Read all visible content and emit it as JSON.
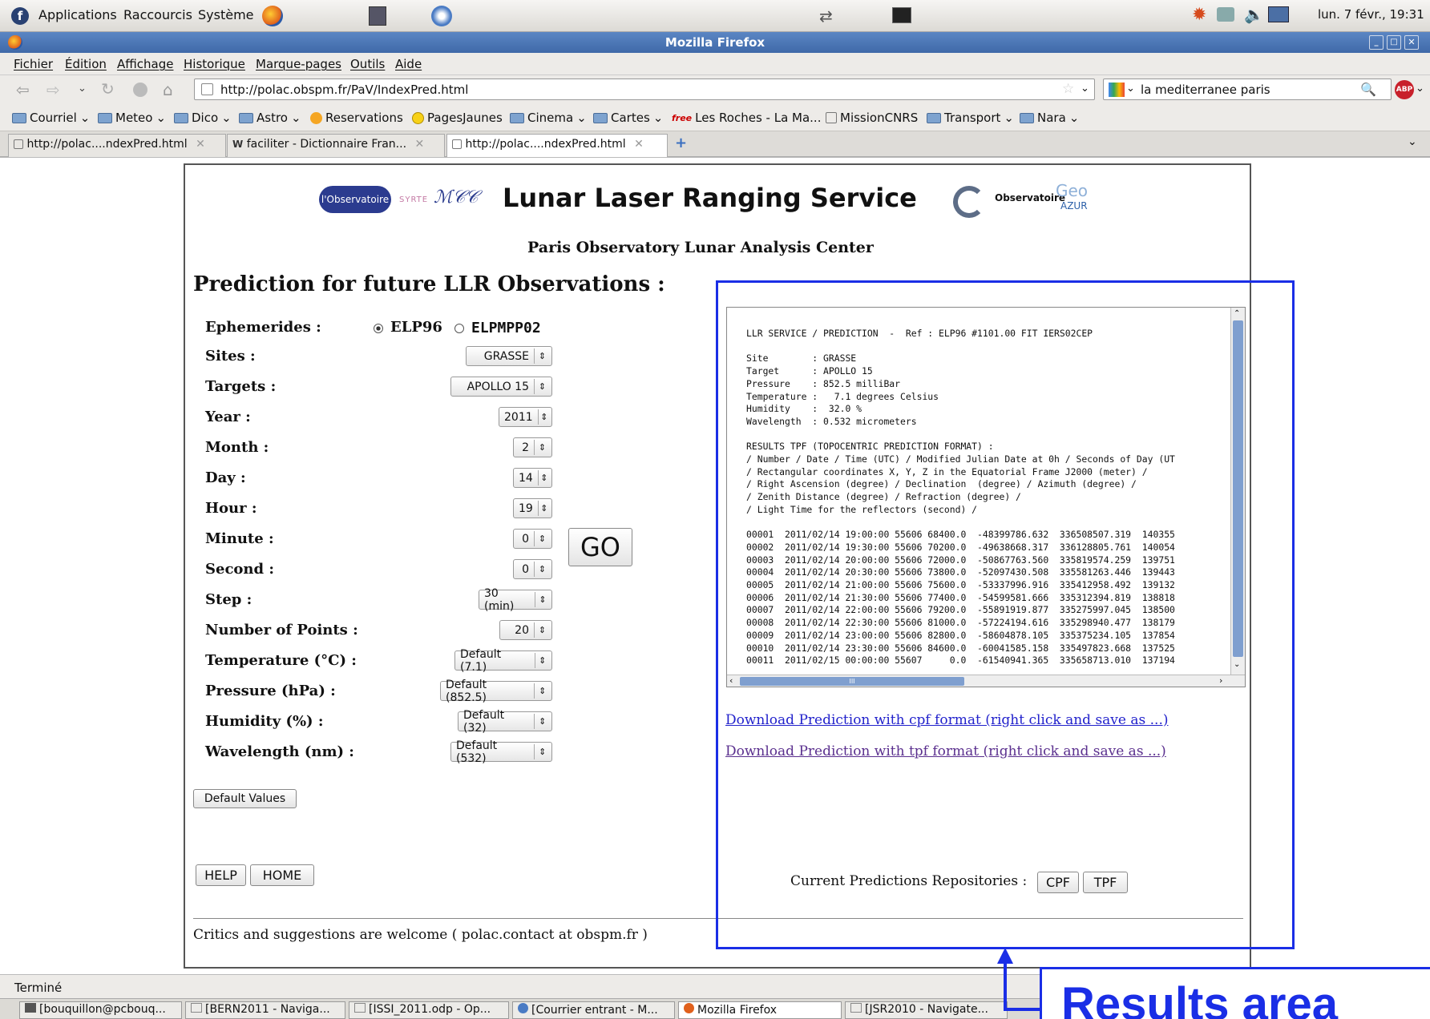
{
  "gnome_panel": {
    "menus": [
      "Applications",
      "Raccourcis",
      "Système"
    ],
    "clock": "lun. 7 févr., 19:31"
  },
  "window": {
    "title": "Mozilla Firefox"
  },
  "menubar": [
    "Fichier",
    "Édition",
    "Affichage",
    "Historique",
    "Marque-pages",
    "Outils",
    "Aide"
  ],
  "navbar": {
    "url": "http://polac.obspm.fr/PaV/IndexPred.html",
    "search": "la mediterranee paris"
  },
  "bookmarks": [
    {
      "label": "Courriel",
      "dropdown": true,
      "icon": "folder-icon"
    },
    {
      "label": "Meteo",
      "dropdown": true,
      "icon": "folder-icon"
    },
    {
      "label": "Dico",
      "dropdown": true,
      "icon": "folder-icon"
    },
    {
      "label": "Astro",
      "dropdown": true,
      "icon": "folder-icon"
    },
    {
      "label": "Reservations",
      "dropdown": false,
      "icon": "reservations-icon"
    },
    {
      "label": "PagesJaunes",
      "dropdown": false,
      "icon": "pagesjaunes-icon"
    },
    {
      "label": "Cinema",
      "dropdown": true,
      "icon": "folder-icon"
    },
    {
      "label": "Cartes",
      "dropdown": true,
      "icon": "folder-icon"
    },
    {
      "label": "Les Roches - La Ma...",
      "dropdown": false,
      "icon": "free-icon"
    },
    {
      "label": "MissionCNRS",
      "dropdown": false,
      "icon": "page-icon"
    },
    {
      "label": "Transport",
      "dropdown": true,
      "icon": "folder-icon"
    },
    {
      "label": "Nara",
      "dropdown": true,
      "icon": "folder-icon"
    }
  ],
  "tabs": [
    {
      "label": "http://polac....ndexPred.html",
      "active": false
    },
    {
      "label": "faciliter - Dictionnaire Fran...",
      "active": false
    },
    {
      "label": "http://polac....ndexPred.html",
      "active": true
    }
  ],
  "header": {
    "logo_observatoire": "l'Observatoire",
    "logo_syrte": "SYRTE",
    "logo_ocazur": "Observatoire",
    "logo_geo": "Geo",
    "logo_azur": "AZUR",
    "title": "Lunar Laser Ranging Service",
    "subtitle": "Paris Observatory Lunar Analysis Center"
  },
  "form": {
    "heading": "Prediction for future LLR Observations :",
    "ephemerides": {
      "label": "Ephemerides :",
      "options": [
        "ELP96",
        "ELPMPP02"
      ],
      "selected": "ELP96"
    },
    "fields": [
      {
        "key": "sites",
        "label": "Sites :",
        "value": "GRASSE"
      },
      {
        "key": "targets",
        "label": "Targets :",
        "value": "APOLLO 15"
      },
      {
        "key": "year",
        "label": "Year :",
        "value": "2011"
      },
      {
        "key": "month",
        "label": "Month :",
        "value": "2"
      },
      {
        "key": "day",
        "label": "Day :",
        "value": "14"
      },
      {
        "key": "hour",
        "label": "Hour :",
        "value": "19"
      },
      {
        "key": "minute",
        "label": "Minute :",
        "value": "0"
      },
      {
        "key": "second",
        "label": "Second :",
        "value": "0"
      },
      {
        "key": "step",
        "label": "Step :",
        "value": "30 (min)"
      },
      {
        "key": "points",
        "label": "Number of Points :",
        "value": "20"
      },
      {
        "key": "temperature",
        "label": "Temperature (°C) :",
        "value": "Default (7.1)"
      },
      {
        "key": "pressure",
        "label": "Pressure (hPa) :",
        "value": "Default (852.5)"
      },
      {
        "key": "humidity",
        "label": "Humidity (%) :",
        "value": "Default (32)"
      },
      {
        "key": "wavelength",
        "label": "Wavelength (nm) :",
        "value": "Default (532)"
      }
    ],
    "go_label": "GO",
    "default_values_label": "Default Values",
    "help_label": "HELP",
    "home_label": "HOME"
  },
  "results": {
    "text": "LLR SERVICE / PREDICTION  -  Ref : ELP96 #1101.00 FIT IERS02CEP\n\nSite        : GRASSE\nTarget      : APOLLO 15\nPressure    : 852.5 milliBar\nTemperature :   7.1 degrees Celsius\nHumidity    :  32.0 %\nWavelength  : 0.532 micrometers\n\nRESULTS TPF (TOPOCENTRIC PREDICTION FORMAT) :\n/ Number / Date / Time (UTC) / Modified Julian Date at 0h / Seconds of Day (UT\n/ Rectangular coordinates X, Y, Z in the Equatorial Frame J2000 (meter) /\n/ Right Ascension (degree) / Declination  (degree) / Azimuth (degree) /\n/ Zenith Distance (degree) / Refraction (degree) /\n/ Light Time for the reflectors (second) /\n\n00001  2011/02/14 19:00:00 55606 68400.0  -48399786.632  336508507.319  140355\n00002  2011/02/14 19:30:00 55606 70200.0  -49638668.317  336128805.761  140054\n00003  2011/02/14 20:00:00 55606 72000.0  -50867763.560  335819574.259  139751\n00004  2011/02/14 20:30:00 55606 73800.0  -52097430.508  335581263.446  139443\n00005  2011/02/14 21:00:00 55606 75600.0  -53337996.916  335412958.492  139132\n00006  2011/02/14 21:30:00 55606 77400.0  -54599581.666  335312394.819  138818\n00007  2011/02/14 22:00:00 55606 79200.0  -55891919.877  335275997.045  138500\n00008  2011/02/14 22:30:00 55606 81000.0  -57224194.616  335298940.477  138179\n00009  2011/02/14 23:00:00 55606 82800.0  -58604878.105  335375234.105  137854\n00010  2011/02/14 23:30:00 55606 84600.0  -60041585.158  335497823.668  137525\n00011  2011/02/15 00:00:00 55607     0.0  -61540941.365  335658713.010  137194",
    "scroll_glyph": "III"
  },
  "downloads": {
    "cpf": "Download Prediction with cpf format (right click and save as ...)",
    "tpf": "Download Prediction with tpf format (right click and save as ...)"
  },
  "repositories": {
    "label": "Current Predictions Repositories :",
    "cpf": "CPF",
    "tpf": "TPF"
  },
  "footer": {
    "text": "Critics and suggestions are welcome ( polac.contact at obspm.fr )"
  },
  "statusbar": {
    "text": "Terminé"
  },
  "taskbar": [
    "[bouquillon@pcbouq...",
    "[BERN2011 - Naviga...",
    "[ISSI_2011.odp - Op...",
    "[Courrier entrant - M...",
    "Mozilla Firefox",
    "[JSR2010 - Navigate..."
  ],
  "annotation": {
    "label": "Results area",
    "color": "#1a2ee6"
  }
}
